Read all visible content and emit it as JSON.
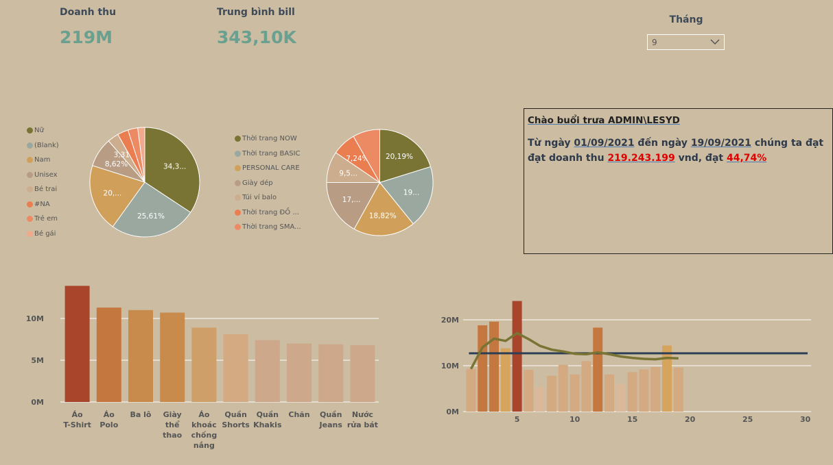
{
  "kpis": [
    {
      "label": "Doanh thu",
      "value": "219M"
    },
    {
      "label": "Trung bình bill",
      "value": "343,10K"
    }
  ],
  "month_filter": {
    "title": "Tháng",
    "selected": "9",
    "icon": "chevron-down-icon"
  },
  "greeting": {
    "title": "Chào buổi trưa ADMIN\\LESYD",
    "part1": "Từ ngày ",
    "start_date": "01/09/2021",
    "part2": " đến ngày ",
    "end_date": "19/09/2021",
    "part3": " chúng ta đạt đạt doanh thu ",
    "revenue": "219.243.199",
    "part4": " vnd, đạt ",
    "percent": "44,74%"
  },
  "colors": {
    "background": "#cbbca2",
    "olive": "#7a7434",
    "gray_green": "#9aa8a0",
    "gold": "#d0a05a",
    "taupe": "#b89c84",
    "beige": "#ccad8e",
    "orange": "#ea7e50",
    "salmon": "#ec8b63",
    "pink": "#f2a88a",
    "dark_red": "#a9452b",
    "navy": "#2e3f55"
  },
  "chart_data": [
    {
      "type": "pie",
      "legend": [
        "Nữ",
        "(Blank)",
        "Nam",
        "Unisex",
        "Bé trai",
        "#NA",
        "Trẻ em",
        "Bé gái"
      ],
      "values": [
        34.3,
        25.61,
        20.0,
        8.62,
        3.31,
        3.2,
        2.9,
        2.06
      ],
      "labels": [
        "34,3...",
        "25,61%",
        "20,...",
        "8,62%",
        "3,31%",
        "",
        "",
        ""
      ],
      "colors": [
        "#7a7434",
        "#9aa8a0",
        "#d0a05a",
        "#b89c84",
        "#ccad8e",
        "#ea7e50",
        "#ec8b63",
        "#f2a88a"
      ]
    },
    {
      "type": "pie",
      "legend": [
        "Thời trang NOW",
        "Thời trang BASIC",
        "PERSONAL CARE",
        "Giày dép",
        "Túi ví balo",
        "Thời trang ĐỒ ...",
        "Thời trang SMA..."
      ],
      "values": [
        20.19,
        19.0,
        18.82,
        17.0,
        9.5,
        7.24,
        8.25
      ],
      "labels": [
        "20,19%",
        "19...",
        "18,82%",
        "17,...",
        "9,5...",
        "7,24%",
        ""
      ],
      "colors": [
        "#7a7434",
        "#9aa8a0",
        "#d0a05a",
        "#b89c84",
        "#ccad8e",
        "#ea7e50",
        "#ec8b63"
      ]
    },
    {
      "type": "bar",
      "categories": [
        "Áo T-Shirt",
        "Áo Polo",
        "Ba lô",
        "Giày thể thao",
        "Áo khoác chống nắng",
        "Quần Shorts",
        "Quần Khakis",
        "Chăn",
        "Quần Jeans",
        "Nước rửa bát"
      ],
      "category_lines": [
        [
          "Áo",
          "T-Shirt"
        ],
        [
          "Áo",
          "Polo"
        ],
        [
          "Ba lô"
        ],
        [
          "Giày",
          "thể",
          "thao"
        ],
        [
          "Áo",
          "khoác",
          "chống",
          "nắng"
        ],
        [
          "Quần",
          "Shorts"
        ],
        [
          "Quần",
          "Khakis"
        ],
        [
          "Chăn"
        ],
        [
          "Quần",
          "Jeans"
        ],
        [
          "Nước",
          "rửa bát"
        ]
      ],
      "values": [
        13.9,
        11.3,
        11.0,
        10.7,
        8.9,
        8.1,
        7.4,
        7.0,
        6.9,
        6.8
      ],
      "colors": [
        "#a9452b",
        "#c4773f",
        "#c98b4c",
        "#c98b4c",
        "#cf9f6a",
        "#d4aa83",
        "#cda88a",
        "#cda88a",
        "#cda88a",
        "#cda88a"
      ],
      "yticks": [
        "0M",
        "5M",
        "10M"
      ],
      "ylim": [
        0,
        14
      ]
    },
    {
      "type": "bar",
      "x": [
        1,
        2,
        3,
        4,
        5,
        6,
        7,
        8,
        9,
        10,
        11,
        12,
        13,
        14,
        15,
        16,
        17,
        18,
        19
      ],
      "values": [
        9.3,
        18.8,
        19.6,
        13.8,
        24.1,
        9.1,
        5.4,
        7.8,
        10.2,
        8.1,
        11.0,
        18.3,
        8.1,
        6.0,
        8.6,
        9.2,
        9.7,
        14.4,
        9.6
      ],
      "colors": [
        "#d4aa83",
        "#c4773f",
        "#c4773f",
        "#d7a45e",
        "#a9452b",
        "#d4aa83",
        "#d9b99a",
        "#d4aa83",
        "#d4aa83",
        "#d4aa83",
        "#d4aa83",
        "#c4773f",
        "#d4aa83",
        "#d9b99a",
        "#d4aa83",
        "#d4aa83",
        "#d4aa83",
        "#d7a45e",
        "#d4aa83"
      ],
      "moving_average": [
        9.3,
        14.0,
        15.9,
        15.4,
        17.1,
        15.8,
        14.3,
        13.5,
        13.1,
        12.6,
        12.5,
        12.9,
        12.5,
        12.0,
        11.7,
        11.5,
        11.4,
        11.7,
        11.6
      ],
      "target_line": 12.7,
      "xticks": [
        "5",
        "10",
        "15",
        "20",
        "25",
        "30"
      ],
      "yticks": [
        "0M",
        "10M",
        "20M"
      ],
      "xlim": [
        0.5,
        30.5
      ],
      "ylim": [
        0,
        25
      ]
    }
  ]
}
